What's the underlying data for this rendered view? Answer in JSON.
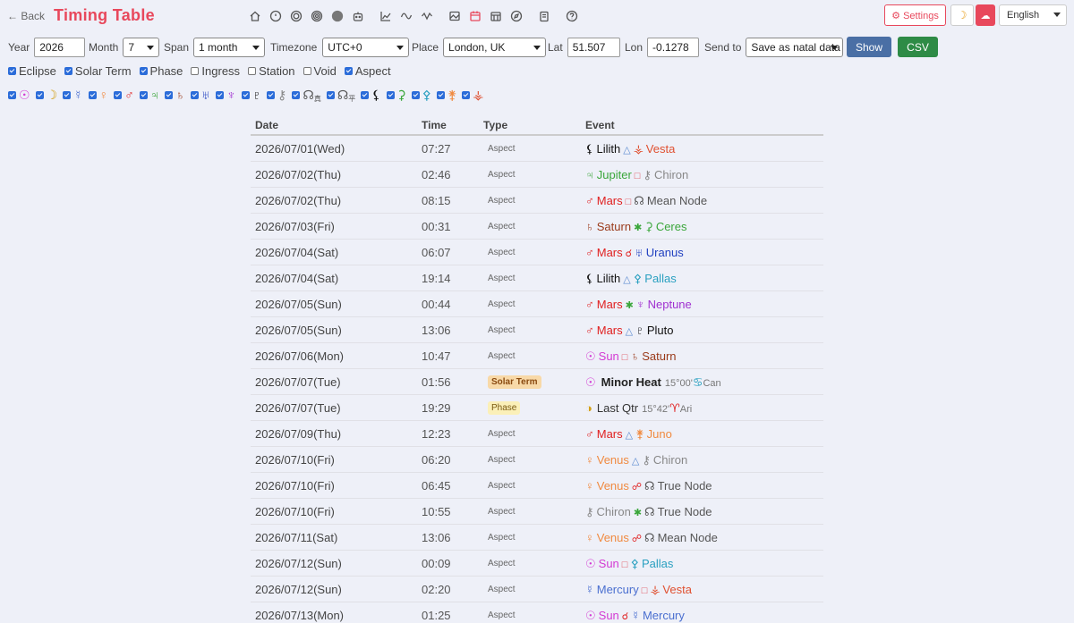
{
  "header": {
    "back_label": "← Back",
    "title": "Timing Table",
    "settings_label": "⚙ Settings",
    "language": "English",
    "colors": {
      "accent": "#e8485c",
      "show": "#4a6fa5",
      "csv": "#2e8b46"
    }
  },
  "controls": {
    "year_label": "Year",
    "year_value": "2026",
    "month_label": "Month",
    "month_value": "7",
    "span_label": "Span",
    "span_value": "1 month",
    "tz_label": "Timezone",
    "tz_value": "UTC+0",
    "place_label": "Place",
    "place_value": "London, UK",
    "lat_label": "Lat",
    "lat_value": "51.507",
    "lon_label": "Lon",
    "lon_value": "-0.1278",
    "send_label": "Send to",
    "send_value": "Save as natal data",
    "show_label": "Show",
    "csv_label": "CSV"
  },
  "filters": [
    {
      "label": "Eclipse",
      "checked": true
    },
    {
      "label": "Solar Term",
      "checked": true
    },
    {
      "label": "Phase",
      "checked": true
    },
    {
      "label": "Ingress",
      "checked": false
    },
    {
      "label": "Station",
      "checked": false
    },
    {
      "label": "Void",
      "checked": false
    },
    {
      "label": "Aspect",
      "checked": true
    }
  ],
  "planets": [
    {
      "glyph": "☉",
      "color": "#d33ad3",
      "sub": ""
    },
    {
      "glyph": "☽",
      "color": "#d4a017",
      "sub": ""
    },
    {
      "glyph": "☿",
      "color": "#4a6fd0",
      "sub": ""
    },
    {
      "glyph": "♀",
      "color": "#f08a40",
      "sub": ""
    },
    {
      "glyph": "♂",
      "color": "#e02020",
      "sub": ""
    },
    {
      "glyph": "♃",
      "color": "#3aa63a",
      "sub": ""
    },
    {
      "glyph": "♄",
      "color": "#9a3a1a",
      "sub": ""
    },
    {
      "glyph": "♅",
      "color": "#2040c0",
      "sub": ""
    },
    {
      "glyph": "♆",
      "color": "#a030d0",
      "sub": ""
    },
    {
      "glyph": "♇",
      "color": "#111111",
      "sub": ""
    },
    {
      "glyph": "⚷",
      "color": "#888888",
      "sub": ""
    },
    {
      "glyph": "☊",
      "color": "#555555",
      "sub": "真"
    },
    {
      "glyph": "☊",
      "color": "#555555",
      "sub": "平"
    },
    {
      "glyph": "⚸",
      "color": "#111111",
      "sub": ""
    },
    {
      "glyph": "⚳",
      "color": "#3aa63a",
      "sub": ""
    },
    {
      "glyph": "⚴",
      "color": "#2aa0c0",
      "sub": ""
    },
    {
      "glyph": "⚵",
      "color": "#f08a40",
      "sub": ""
    },
    {
      "glyph": "⚶",
      "color": "#e05030",
      "sub": ""
    }
  ],
  "table": {
    "headers": {
      "date": "Date",
      "time": "Time",
      "type": "Type",
      "event": "Event"
    },
    "rows": [
      {
        "date": "2026/07/01(Wed)",
        "time": "07:27",
        "type": "Aspect",
        "p1g": "⚸",
        "p1": "Lilith",
        "p1c": "#111111",
        "asp": "△",
        "aspc": "#5a8ad0",
        "p2g": "⚶",
        "p2": "Vesta",
        "p2c": "#e05030"
      },
      {
        "date": "2026/07/02(Thu)",
        "time": "02:46",
        "type": "Aspect",
        "p1g": "♃",
        "p1": "Jupiter",
        "p1c": "#3aa63a",
        "asp": "□",
        "aspc": "#e0505a",
        "p2g": "⚷",
        "p2": "Chiron",
        "p2c": "#888888"
      },
      {
        "date": "2026/07/02(Thu)",
        "time": "08:15",
        "type": "Aspect",
        "p1g": "♂",
        "p1": "Mars",
        "p1c": "#e02020",
        "asp": "□",
        "aspc": "#e0505a",
        "p2g": "☊",
        "p2": "Mean Node",
        "p2c": "#555555"
      },
      {
        "date": "2026/07/03(Fri)",
        "time": "00:31",
        "type": "Aspect",
        "p1g": "♄",
        "p1": "Saturn",
        "p1c": "#9a3a1a",
        "asp": "✱",
        "aspc": "#3aa63a",
        "p2g": "⚳",
        "p2": "Ceres",
        "p2c": "#3aa63a"
      },
      {
        "date": "2026/07/04(Sat)",
        "time": "06:07",
        "type": "Aspect",
        "p1g": "♂",
        "p1": "Mars",
        "p1c": "#e02020",
        "asp": "☌",
        "aspc": "#e02020",
        "p2g": "♅",
        "p2": "Uranus",
        "p2c": "#2040c0"
      },
      {
        "date": "2026/07/04(Sat)",
        "time": "19:14",
        "type": "Aspect",
        "p1g": "⚸",
        "p1": "Lilith",
        "p1c": "#111111",
        "asp": "△",
        "aspc": "#5a8ad0",
        "p2g": "⚴",
        "p2": "Pallas",
        "p2c": "#2aa0c0"
      },
      {
        "date": "2026/07/05(Sun)",
        "time": "00:44",
        "type": "Aspect",
        "p1g": "♂",
        "p1": "Mars",
        "p1c": "#e02020",
        "asp": "✱",
        "aspc": "#3aa63a",
        "p2g": "♆",
        "p2": "Neptune",
        "p2c": "#a030d0"
      },
      {
        "date": "2026/07/05(Sun)",
        "time": "13:06",
        "type": "Aspect",
        "p1g": "♂",
        "p1": "Mars",
        "p1c": "#e02020",
        "asp": "△",
        "aspc": "#5a8ad0",
        "p2g": "♇",
        "p2": "Pluto",
        "p2c": "#111111"
      },
      {
        "date": "2026/07/06(Mon)",
        "time": "10:47",
        "type": "Aspect",
        "p1g": "☉",
        "p1": "Sun",
        "p1c": "#d33ad3",
        "asp": "□",
        "aspc": "#e0505a",
        "p2g": "♄",
        "p2": "Saturn",
        "p2c": "#9a3a1a"
      },
      {
        "date": "2026/07/07(Tue)",
        "time": "01:56",
        "type": "Solar Term",
        "badge": "term",
        "p1g": "☉",
        "p1": "",
        "p1c": "#d33ad3",
        "main": "Minor Heat",
        "deg": "15°00'",
        "signg": "♋",
        "signc": "#2aa0c0",
        "sign": "Can"
      },
      {
        "date": "2026/07/07(Tue)",
        "time": "19:29",
        "type": "Phase",
        "badge": "phase",
        "p1g": "◑",
        "p1": "",
        "p1c": "#d4a017",
        "phase": "Last Qtr",
        "deg": "15°42'",
        "signg": "♈",
        "signc": "#e02020",
        "sign": "Ari"
      },
      {
        "date": "2026/07/09(Thu)",
        "time": "12:23",
        "type": "Aspect",
        "p1g": "♂",
        "p1": "Mars",
        "p1c": "#e02020",
        "asp": "△",
        "aspc": "#5a8ad0",
        "p2g": "⚵",
        "p2": "Juno",
        "p2c": "#f08a40"
      },
      {
        "date": "2026/07/10(Fri)",
        "time": "06:20",
        "type": "Aspect",
        "p1g": "♀",
        "p1": "Venus",
        "p1c": "#f08a40",
        "asp": "△",
        "aspc": "#5a8ad0",
        "p2g": "⚷",
        "p2": "Chiron",
        "p2c": "#888888"
      },
      {
        "date": "2026/07/10(Fri)",
        "time": "06:45",
        "type": "Aspect",
        "p1g": "♀",
        "p1": "Venus",
        "p1c": "#f08a40",
        "asp": "☍",
        "aspc": "#e02020",
        "p2g": "☊",
        "p2": "True Node",
        "p2c": "#555555"
      },
      {
        "date": "2026/07/10(Fri)",
        "time": "10:55",
        "type": "Aspect",
        "p1g": "⚷",
        "p1": "Chiron",
        "p1c": "#888888",
        "asp": "✱",
        "aspc": "#3aa63a",
        "p2g": "☊",
        "p2": "True Node",
        "p2c": "#555555"
      },
      {
        "date": "2026/07/11(Sat)",
        "time": "13:06",
        "type": "Aspect",
        "p1g": "♀",
        "p1": "Venus",
        "p1c": "#f08a40",
        "asp": "☍",
        "aspc": "#e02020",
        "p2g": "☊",
        "p2": "Mean Node",
        "p2c": "#555555"
      },
      {
        "date": "2026/07/12(Sun)",
        "time": "00:09",
        "type": "Aspect",
        "p1g": "☉",
        "p1": "Sun",
        "p1c": "#d33ad3",
        "asp": "□",
        "aspc": "#e0505a",
        "p2g": "⚴",
        "p2": "Pallas",
        "p2c": "#2aa0c0"
      },
      {
        "date": "2026/07/12(Sun)",
        "time": "02:20",
        "type": "Aspect",
        "p1g": "☿",
        "p1": "Mercury",
        "p1c": "#4a6fd0",
        "asp": "□",
        "aspc": "#e0505a",
        "p2g": "⚶",
        "p2": "Vesta",
        "p2c": "#e05030"
      },
      {
        "date": "2026/07/13(Mon)",
        "time": "01:25",
        "type": "Aspect",
        "p1g": "☉",
        "p1": "Sun",
        "p1c": "#d33ad3",
        "asp": "☌",
        "aspc": "#e02020",
        "p2g": "☿",
        "p2": "Mercury",
        "p2c": "#4a6fd0"
      }
    ]
  }
}
